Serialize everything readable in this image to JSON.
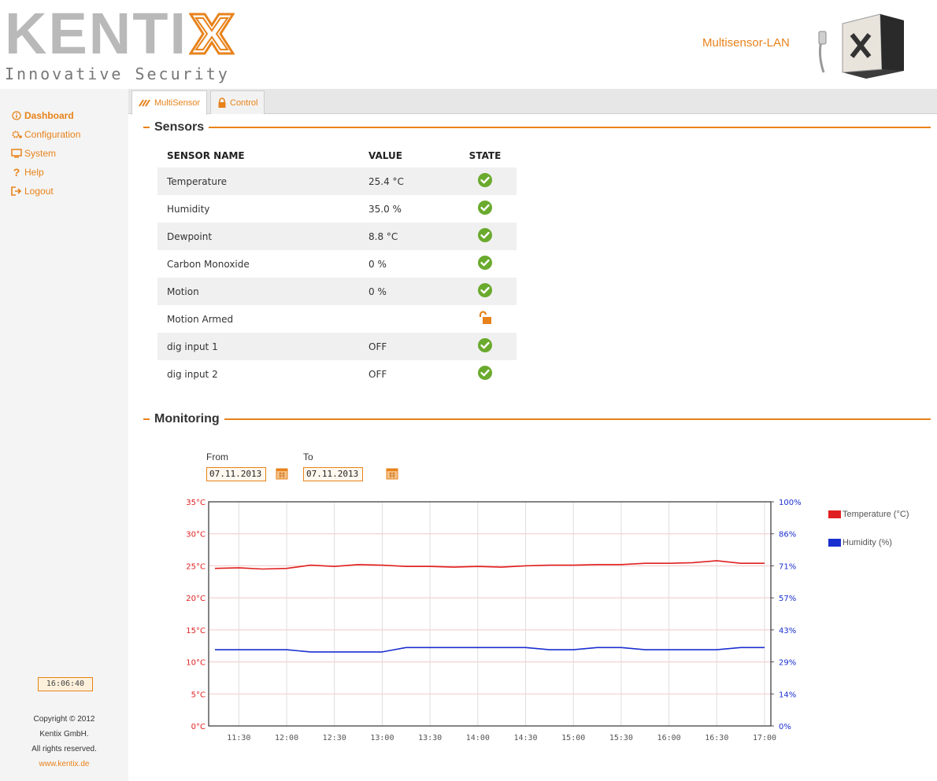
{
  "header": {
    "logo_word": "KENTI",
    "logo_tagline": "Innovative Security",
    "product": "Multisensor-LAN"
  },
  "sidebar": {
    "items": [
      {
        "label": "Dashboard",
        "icon": "info-circle-icon"
      },
      {
        "label": "Configuration",
        "icon": "gears-icon"
      },
      {
        "label": "System",
        "icon": "monitor-icon"
      },
      {
        "label": "Help",
        "icon": "question-icon"
      },
      {
        "label": "Logout",
        "icon": "logout-icon"
      }
    ],
    "clock": "16:06:40",
    "copyright": [
      "Copyright © 2012",
      "Kentix GmbH.",
      "All rights reserved."
    ],
    "website": "www.kentix.de"
  },
  "tabs": [
    {
      "label": "MultiSensor",
      "icon": "wave-icon"
    },
    {
      "label": "Control",
      "icon": "lock-icon"
    }
  ],
  "sensors": {
    "title": "Sensors",
    "columns": [
      "SENSOR NAME",
      "VALUE",
      "STATE"
    ],
    "rows": [
      {
        "name": "Temperature",
        "value": "25.4 °C",
        "state": "ok"
      },
      {
        "name": "Humidity",
        "value": "35.0 %",
        "state": "ok"
      },
      {
        "name": "Dewpoint",
        "value": "8.8 °C",
        "state": "ok"
      },
      {
        "name": "Carbon Monoxide",
        "value": "0 %",
        "state": "ok"
      },
      {
        "name": "Motion",
        "value": "0 %",
        "state": "ok"
      },
      {
        "name": "Motion Armed",
        "value": "",
        "state": "unlocked"
      },
      {
        "name": "dig input 1",
        "value": "OFF",
        "state": "ok"
      },
      {
        "name": "dig input 2",
        "value": "OFF",
        "state": "ok"
      }
    ]
  },
  "monitoring": {
    "title": "Monitoring",
    "from_label": "From",
    "from_value": "07.11.2013",
    "to_label": "To",
    "to_value": "07.11.2013"
  },
  "colors": {
    "accent": "#e8821a",
    "ok": "#6aaa2d",
    "temperature": "#e02020",
    "humidity": "#1a2fd0"
  },
  "chart_data": {
    "type": "line",
    "x": [
      "11:15",
      "11:30",
      "11:45",
      "12:00",
      "12:15",
      "12:30",
      "12:45",
      "13:00",
      "13:15",
      "13:30",
      "13:45",
      "14:00",
      "14:15",
      "14:30",
      "14:45",
      "15:00",
      "15:15",
      "15:30",
      "15:45",
      "16:00",
      "16:15",
      "16:30",
      "16:45",
      "17:00"
    ],
    "x_ticks": [
      "11:30",
      "12:00",
      "12:30",
      "13:00",
      "13:30",
      "14:00",
      "14:30",
      "15:00",
      "15:30",
      "16:00",
      "16:30",
      "17:00"
    ],
    "series": [
      {
        "name": "Temperature (°C)",
        "axis": "left",
        "values": [
          24.6,
          24.7,
          24.5,
          24.6,
          25.1,
          24.9,
          25.2,
          25.1,
          24.9,
          24.9,
          24.8,
          24.9,
          24.8,
          25.0,
          25.1,
          25.1,
          25.2,
          25.2,
          25.4,
          25.4,
          25.5,
          25.8,
          25.4,
          25.4
        ]
      },
      {
        "name": "Humidity (%)",
        "axis": "right",
        "values": [
          34.0,
          34.0,
          34.0,
          34.0,
          33.0,
          33.0,
          33.0,
          33.0,
          35.0,
          35.0,
          35.0,
          35.0,
          35.0,
          35.0,
          34.0,
          34.0,
          35.0,
          35.0,
          34.0,
          34.0,
          34.0,
          34.0,
          35.0,
          35.0
        ]
      }
    ],
    "y_left_ticks": [
      "0°C",
      "5°C",
      "10°C",
      "15°C",
      "20°C",
      "25°C",
      "30°C",
      "35°C"
    ],
    "y_left_range": [
      0,
      35
    ],
    "y_right_ticks": [
      "0%",
      "14%",
      "29%",
      "43%",
      "57%",
      "71%",
      "86%",
      "100%"
    ],
    "y_right_range": [
      0,
      100
    ],
    "legend_position": "right",
    "grid": true
  }
}
